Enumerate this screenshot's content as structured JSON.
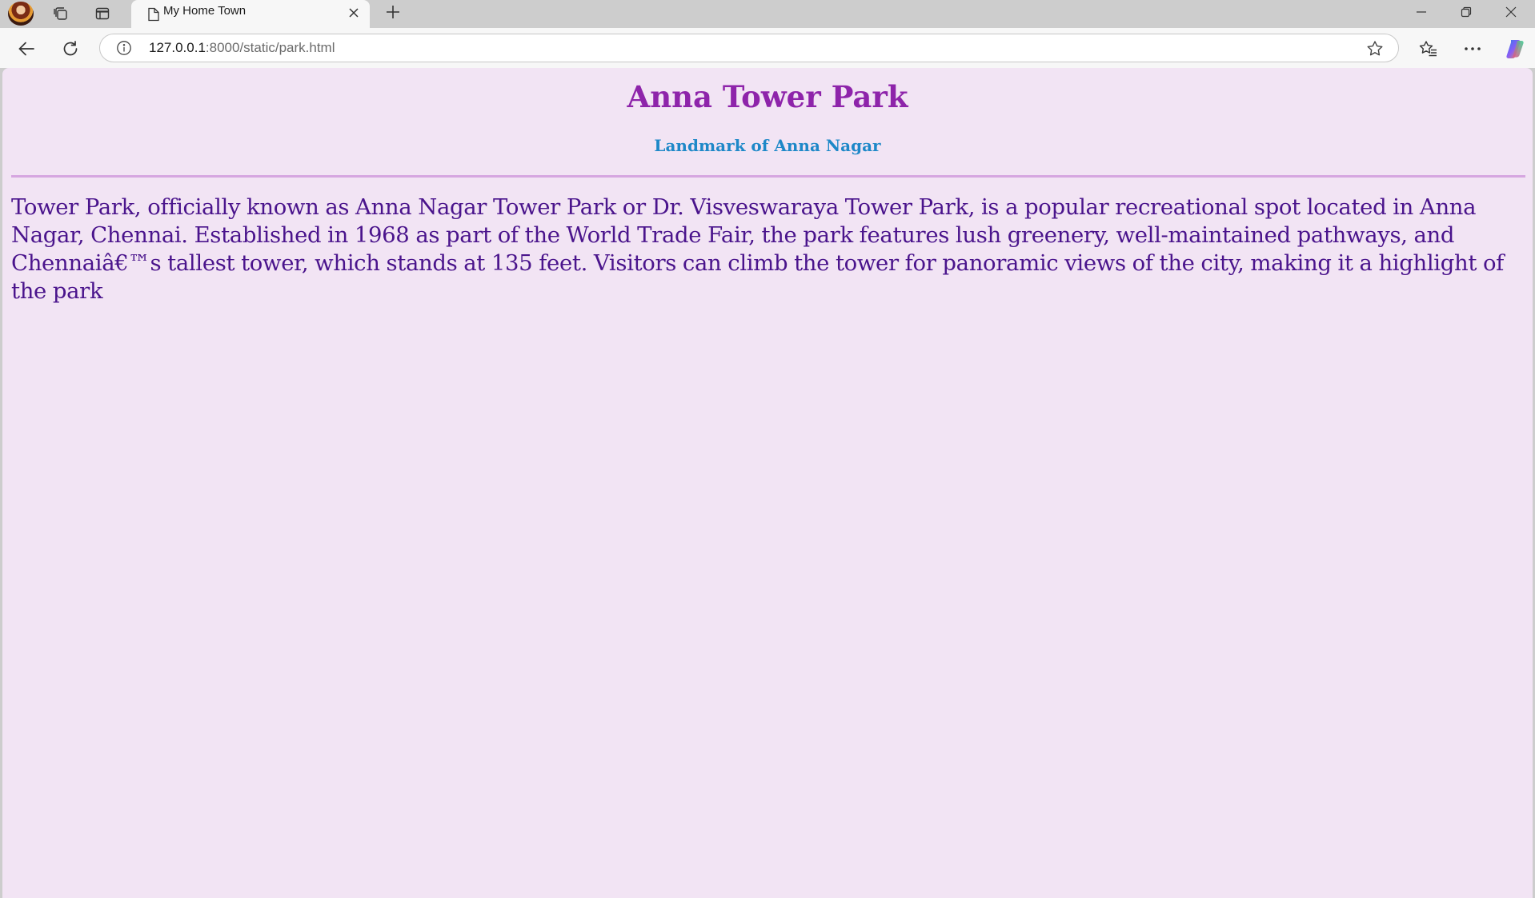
{
  "browser": {
    "tab": {
      "title": "My Home Town"
    },
    "address": {
      "host": "127.0.0.1",
      "path": ":8000/static/park.html"
    },
    "icons": {
      "profile": "avatar",
      "workspaces": "workspaces-icon",
      "tab_actions": "tab-actions-icon",
      "page": "page-icon",
      "close_tab": "close-icon",
      "new_tab": "plus-icon",
      "back": "back-arrow-icon",
      "reload": "reload-icon",
      "info": "info-icon",
      "favorite": "star-icon",
      "favorites": "favorites-icon",
      "more": "more-icon",
      "copilot": "copilot-icon",
      "minimize": "minimize-icon",
      "restore": "restore-icon",
      "close_window": "close-window-icon"
    }
  },
  "page": {
    "title": "Anna Tower Park",
    "subtitle": "Landmark of Anna Nagar",
    "paragraph": "Tower Park, officially known as Anna Nagar Tower Park or Dr. Visveswaraya Tower Park, is a popular recreational spot located in Anna Nagar, Chennai. Established in 1968 as part of the World Trade Fair, the park features lush greenery, well-maintained pathways, and Chennaiâ€™s tallest tower, which stands at 135 feet. Visitors can climb the tower for panoramic views of the city, making it a highlight of the park"
  },
  "colors": {
    "page_background": "#f2e4f4",
    "title": "#8e24aa",
    "subtitle": "#1e88c8",
    "divider": "#d6a6e0",
    "paragraph": "#4a148c"
  }
}
